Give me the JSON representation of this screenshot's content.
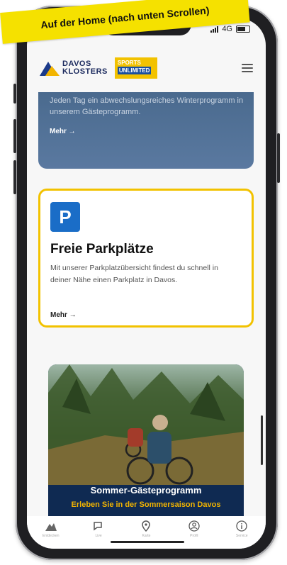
{
  "banner": {
    "text": "Auf der Home (nach unten Scrollen)"
  },
  "status": {
    "network": "4G"
  },
  "header": {
    "logo_line1": "DAVOS",
    "logo_line2": "KLOSTERS",
    "partner_line1": "SPORTS",
    "partner_line2": "UNLIMITED"
  },
  "prev_card": {
    "text": "Jeden Tag ein abwechslungsreiches Winterprogramm in unserem Gästeprogramm.",
    "more": "Mehr →"
  },
  "parking_card": {
    "icon_letter": "P",
    "title": "Freie Parkplätze",
    "description": "Mit unserer Parkplatzübersicht findest du schnell in deiner Nähe einen Parkplatz in Davos.",
    "more": "Mehr →"
  },
  "summer_card": {
    "title": "Sommer-Gästeprogramm",
    "subtitle": "Erleben Sie in der Sommersaison Davos"
  },
  "tabs": [
    {
      "icon": "mountain-icon",
      "label": "Entdecken"
    },
    {
      "icon": "chat-icon",
      "label": "Live"
    },
    {
      "icon": "map-pin-icon",
      "label": "Karte"
    },
    {
      "icon": "user-icon",
      "label": "Profil"
    },
    {
      "icon": "info-icon",
      "label": "Service"
    }
  ],
  "colors": {
    "highlight": "#f2c200",
    "brand_blue": "#1a6dc7",
    "navy": "#0f2a52"
  }
}
